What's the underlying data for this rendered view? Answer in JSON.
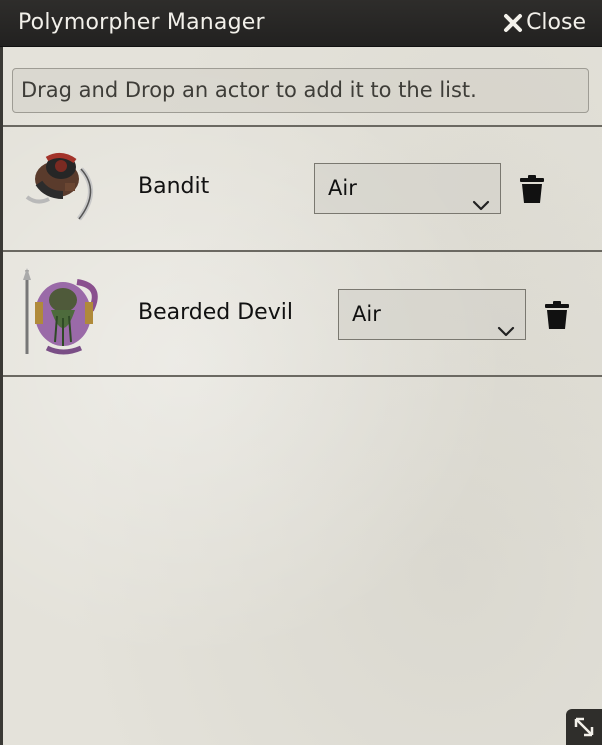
{
  "window": {
    "title": "Polymorpher Manager",
    "close_label": "Close"
  },
  "hint": {
    "text": "Drag and Drop an actor to add it to the list."
  },
  "actors": [
    {
      "name": "Bandit",
      "form": "Air",
      "token_icon": "bandit-token-icon"
    },
    {
      "name": "Bearded Devil",
      "form": "Air",
      "token_icon": "bearded-devil-token-icon"
    }
  ],
  "colors": {
    "titlebar": "#2a2927",
    "panel": "#e4e2da",
    "text": "#111111"
  }
}
